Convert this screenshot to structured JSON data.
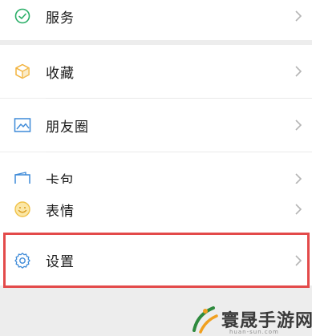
{
  "menu": {
    "items": [
      {
        "label": "服务",
        "icon": "service-icon"
      },
      {
        "label": "收藏",
        "icon": "favorites-cube-icon"
      },
      {
        "label": "朋友圈",
        "icon": "moments-image-icon"
      },
      {
        "label": "卡包",
        "icon": "card-wallet-icon"
      },
      {
        "label": "表情",
        "icon": "sticker-smiley-icon"
      },
      {
        "label": "设置",
        "icon": "settings-gear-icon"
      }
    ]
  },
  "highlight": {
    "target": "设置",
    "color": "#e34a4a"
  },
  "watermark": {
    "name": "寰晟手游网",
    "site": "huan-sun.com"
  }
}
